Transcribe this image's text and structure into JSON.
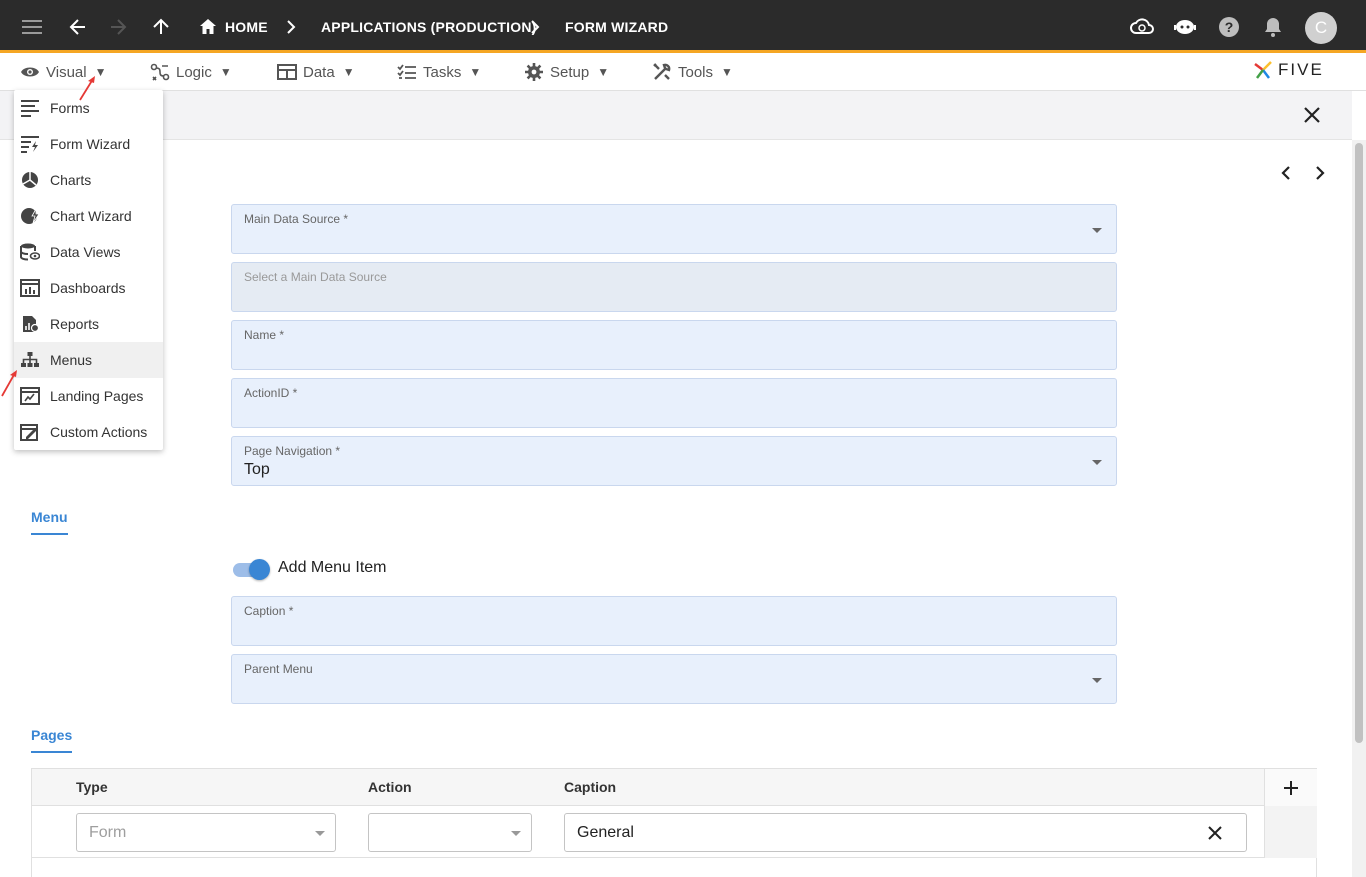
{
  "topbar": {
    "breadcrumbs": [
      "HOME",
      "APPLICATIONS (PRODUCTION)",
      "FORM WIZARD"
    ],
    "avatar_initial": "C",
    "accent_color": "#f5a623"
  },
  "menubar": {
    "items": [
      "Visual",
      "Logic",
      "Data",
      "Tasks",
      "Setup",
      "Tools"
    ],
    "caret": "▼"
  },
  "logo": {
    "text": "FIVE"
  },
  "visual_menu": {
    "items": [
      {
        "label": "Forms",
        "icon": "forms-icon"
      },
      {
        "label": "Form Wizard",
        "icon": "form-wizard-icon"
      },
      {
        "label": "Charts",
        "icon": "charts-icon"
      },
      {
        "label": "Chart Wizard",
        "icon": "chart-wizard-icon"
      },
      {
        "label": "Data Views",
        "icon": "data-views-icon"
      },
      {
        "label": "Dashboards",
        "icon": "dashboards-icon"
      },
      {
        "label": "Reports",
        "icon": "reports-icon"
      },
      {
        "label": "Menus",
        "icon": "menus-icon"
      },
      {
        "label": "Landing Pages",
        "icon": "landing-pages-icon"
      },
      {
        "label": "Custom Actions",
        "icon": "custom-actions-icon"
      }
    ],
    "highlighted": "Menus"
  },
  "form": {
    "main_data_source": {
      "label": "Main Data Source *",
      "value": ""
    },
    "select_source": {
      "label": "Select a Main Data Source",
      "value": ""
    },
    "name": {
      "label": "Name *",
      "value": ""
    },
    "action_id": {
      "label": "ActionID *",
      "value": ""
    },
    "page_navigation": {
      "label": "Page Navigation *",
      "value": "Top"
    }
  },
  "menu_section": {
    "title": "Menu",
    "toggle_label": "Add Menu Item",
    "toggle_on": true,
    "caption": {
      "label": "Caption *",
      "value": ""
    },
    "parent_menu": {
      "label": "Parent Menu",
      "value": ""
    }
  },
  "pages_section": {
    "title": "Pages",
    "columns": [
      "Type",
      "Action",
      "Caption"
    ],
    "rows": [
      {
        "type": "Form",
        "action": "",
        "caption": "General"
      }
    ]
  }
}
